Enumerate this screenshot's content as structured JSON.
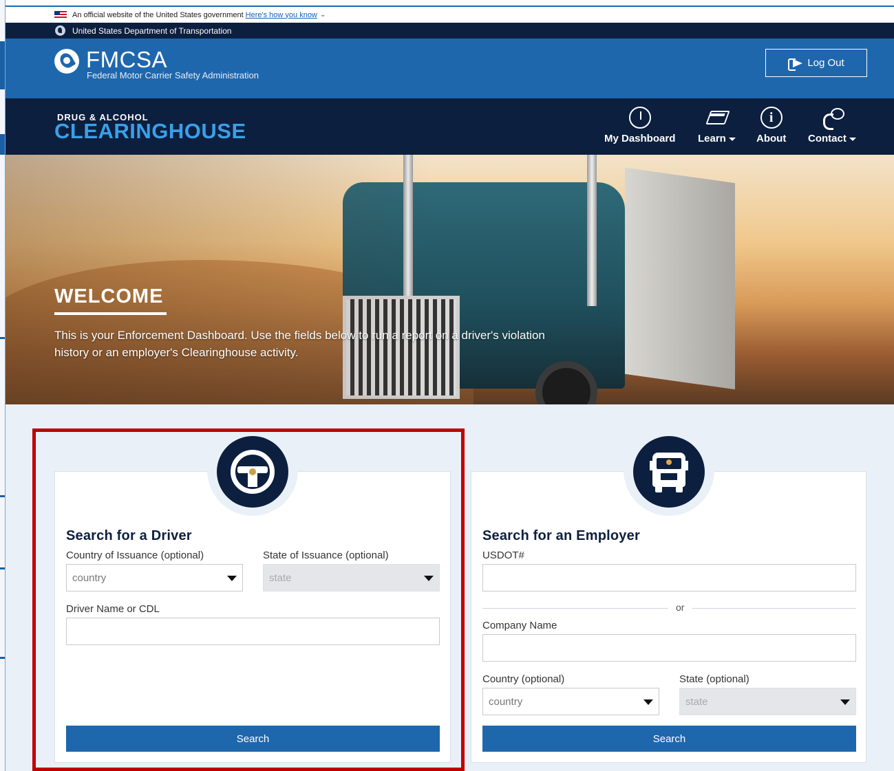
{
  "gov_banner": {
    "text": "An official website of the United States government",
    "link": "Here's how you know"
  },
  "dot_bar": {
    "text": "United States Department of Transportation"
  },
  "fmcsa": {
    "name": "FMCSA",
    "subtitle": "Federal Motor Carrier Safety Administration",
    "logout_label": "Log Out"
  },
  "clearinghouse": {
    "small": "DRUG & ALCOHOL",
    "big": "CLEARINGHOUSE"
  },
  "nav": {
    "dashboard": "My Dashboard",
    "learn": "Learn",
    "about": "About",
    "contact": "Contact"
  },
  "hero": {
    "welcome": "WELCOME",
    "text": "This is your Enforcement Dashboard. Use the fields below to run a report on a driver's violation history or an employer's Clearinghouse activity."
  },
  "driver_search": {
    "title": "Search for a Driver",
    "country_label": "Country of Issuance (optional)",
    "country_value": "country",
    "state_label": "State of Issuance (optional)",
    "state_value": "state",
    "name_label": "Driver Name or CDL",
    "search_label": "Search"
  },
  "employer_search": {
    "title": "Search for an Employer",
    "usdot_label": "USDOT#",
    "or_text": "or",
    "company_label": "Company Name",
    "country_label": "Country (optional)",
    "country_value": "country",
    "state_label": "State (optional)",
    "state_value": "state",
    "search_label": "Search"
  },
  "colors": {
    "navy": "#0c1f3f",
    "brand_blue": "#1f67ad",
    "accent_light_blue": "#3aa0e8",
    "highlight_red": "#c00000",
    "search_bg": "#e9f0f8"
  },
  "icons": [
    "flag-icon",
    "dot-logo-icon",
    "fmcsa-logo-icon",
    "logout-icon",
    "dashboard-gauge-icon",
    "book-icon",
    "info-icon",
    "phone-icon",
    "steering-wheel-icon",
    "truck-icon",
    "chevron-down-icon"
  ]
}
